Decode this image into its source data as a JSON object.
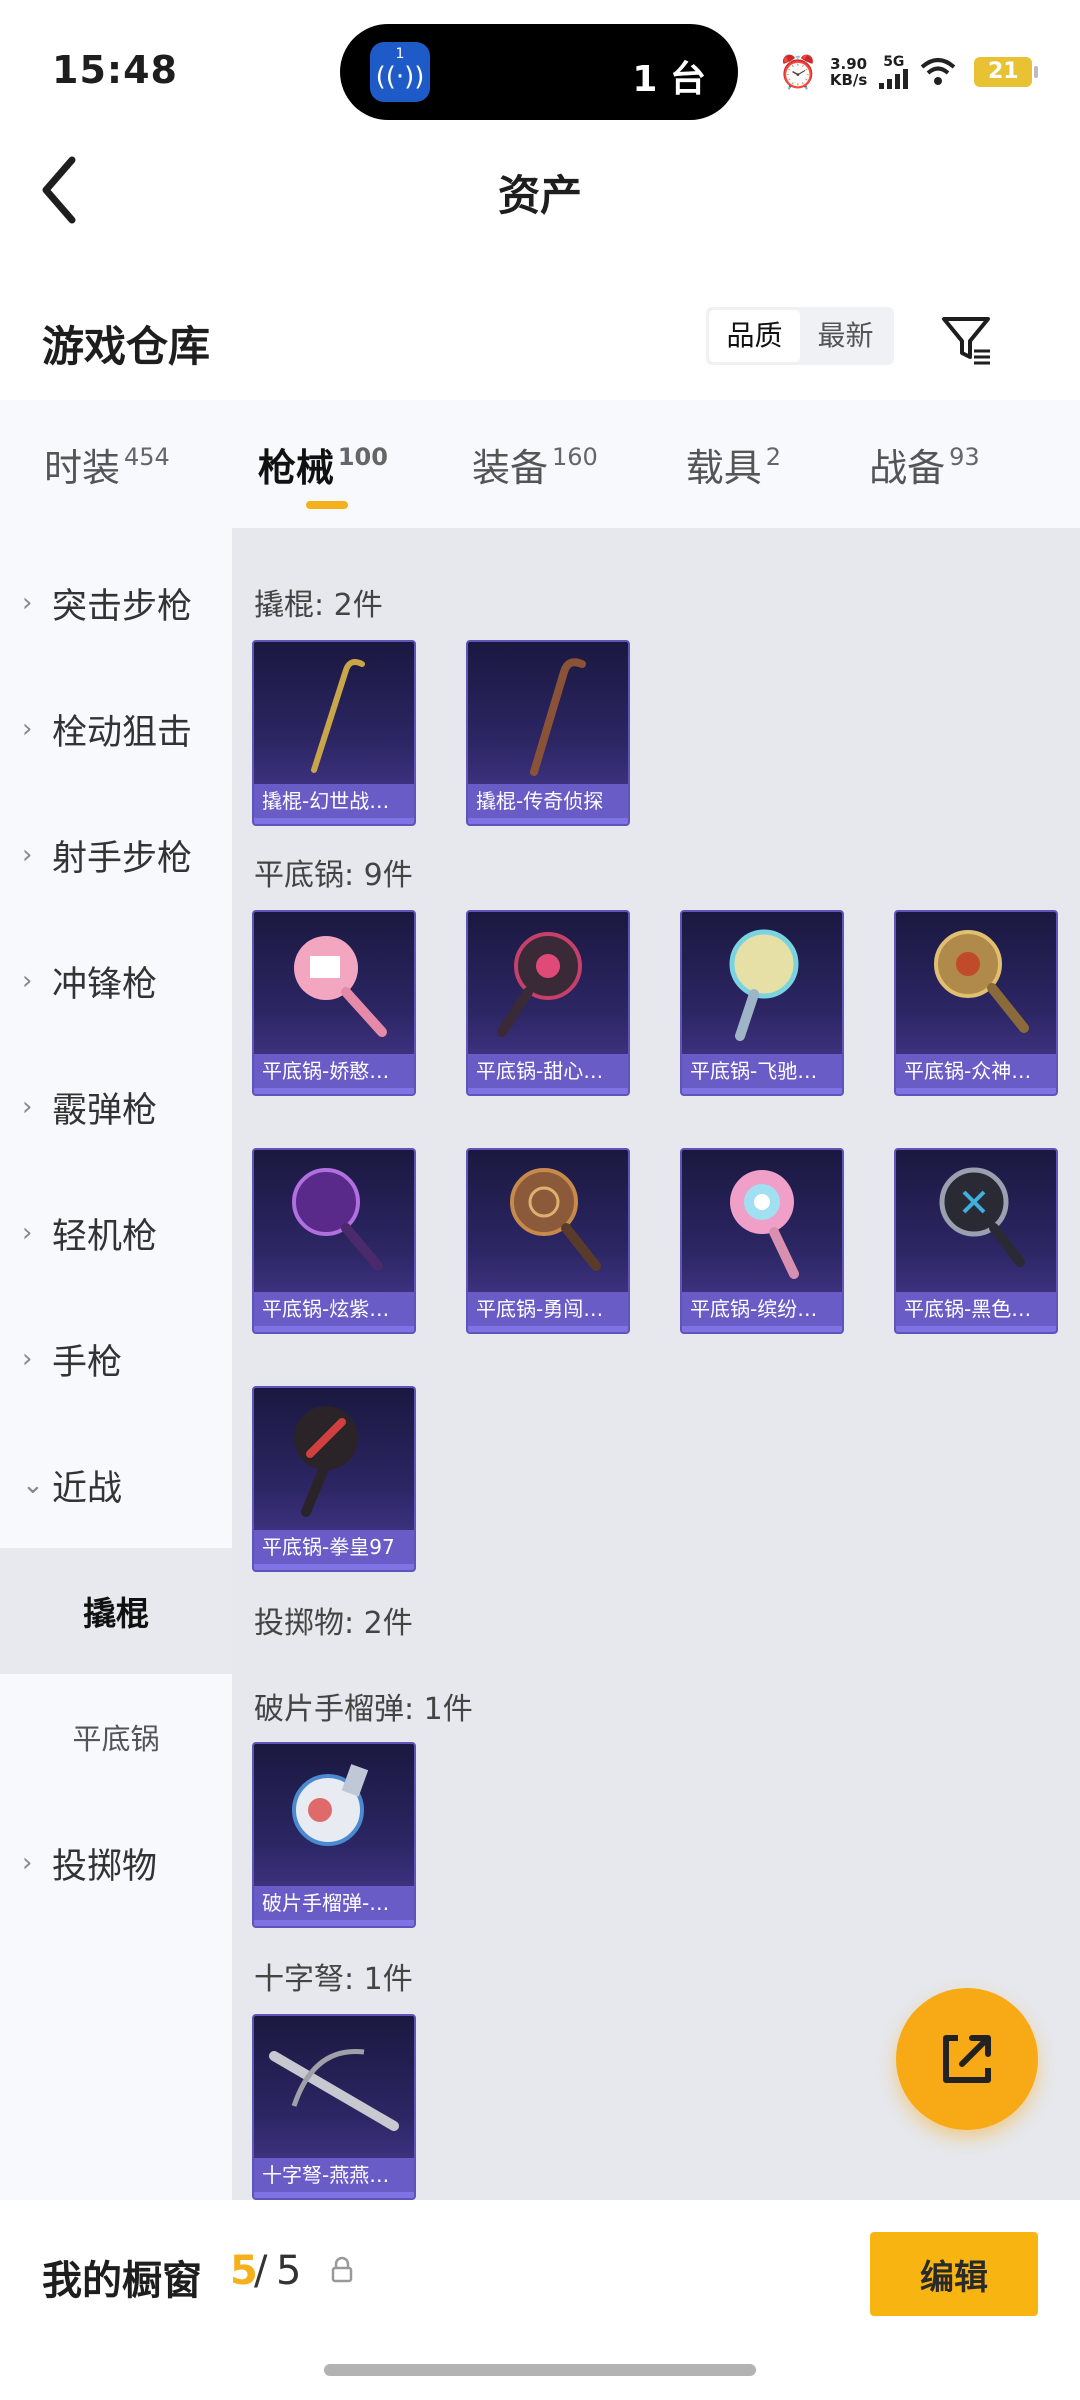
{
  "status_bar": {
    "time": "15:48",
    "island_badge": "1",
    "island_count": "1 台",
    "net_speed_value": "3.90",
    "net_speed_unit": "KB/s",
    "network": "5G",
    "battery": "21"
  },
  "header": {
    "title": "资产"
  },
  "warehouse": {
    "title": "游戏仓库",
    "sort_quality": "品质",
    "sort_latest": "最新"
  },
  "tabs": [
    {
      "label": "时装",
      "count": "454"
    },
    {
      "label": "枪械",
      "count": "100"
    },
    {
      "label": "装备",
      "count": "160"
    },
    {
      "label": "载具",
      "count": "2"
    },
    {
      "label": "战备",
      "count": "93"
    }
  ],
  "sidebar": {
    "cats": [
      "突击步枪",
      "栓动狙击",
      "射手步枪",
      "冲锋枪",
      "霰弹枪",
      "轻机枪",
      "手枪"
    ],
    "melee": "近战",
    "subs": [
      "撬棍",
      "平底锅"
    ],
    "throwables": "投掷物"
  },
  "sections": {
    "crowbar": "撬棍: 2件",
    "pan": "平底锅: 9件",
    "throwables": "投掷物: 2件",
    "grenade": "破片手榴弹: 1件",
    "crossbow": "十字弩: 1件"
  },
  "items": {
    "crowbar": [
      "撬棍-幻世战…",
      "撬棍-传奇侦探"
    ],
    "pan": [
      "平底锅-娇憨…",
      "平底锅-甜心…",
      "平底锅-飞驰…",
      "平底锅-众神…",
      "平底锅-炫紫…",
      "平底锅-勇闯…",
      "平底锅-缤纷…",
      "平底锅-黑色…",
      "平底锅-拳皇97"
    ],
    "grenade": [
      "破片手榴弹-…"
    ],
    "crossbow": [
      "十字弩-燕燕…"
    ]
  },
  "bottom": {
    "label": "我的橱窗",
    "current": "5",
    "total": "5",
    "edit": "编辑"
  },
  "colors": {
    "accent": "#f5b11c",
    "card_bg": "#2c2664",
    "caption": "#6a5cc7"
  },
  "icons": {
    "back": "chevron-left-icon",
    "filter": "filter-icon",
    "share": "external-link-icon",
    "lock": "lock-icon",
    "alarm": "alarm-icon",
    "wifi": "wifi-icon"
  }
}
